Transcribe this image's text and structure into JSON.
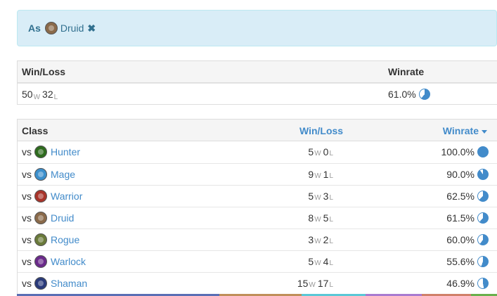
{
  "filter": {
    "prefix": "As",
    "class_name": "Druid",
    "class_icon": "druid-icon",
    "class_color": "#8a6a4a"
  },
  "summary": {
    "headers": {
      "winloss": "Win/Loss",
      "winrate": "Winrate"
    },
    "wins": "50",
    "wins_suffix": "W",
    "losses": "32",
    "losses_suffix": "L",
    "winrate": "61.0%",
    "winrate_value": 0.61
  },
  "classes": {
    "headers": {
      "class": "Class",
      "winloss": "Win/Loss",
      "winrate": "Winrate"
    },
    "vs_label": "vs",
    "rows": [
      {
        "name": "Hunter",
        "icon": "hunter-icon",
        "color": "#2e6b1e",
        "wins": "5",
        "losses": "0",
        "winrate": "100.0%",
        "value": 1.0
      },
      {
        "name": "Mage",
        "icon": "mage-icon",
        "color": "#3c8fcc",
        "wins": "9",
        "losses": "1",
        "winrate": "90.0%",
        "value": 0.9
      },
      {
        "name": "Warrior",
        "icon": "warrior-icon",
        "color": "#a8342a",
        "wins": "5",
        "losses": "3",
        "winrate": "62.5%",
        "value": 0.625
      },
      {
        "name": "Druid",
        "icon": "druid-icon",
        "color": "#8a6a4a",
        "wins": "8",
        "losses": "5",
        "winrate": "61.5%",
        "value": 0.615
      },
      {
        "name": "Rogue",
        "icon": "rogue-icon",
        "color": "#6a7a3a",
        "wins": "3",
        "losses": "2",
        "winrate": "60.0%",
        "value": 0.6
      },
      {
        "name": "Warlock",
        "icon": "warlock-icon",
        "color": "#6a2a8a",
        "wins": "5",
        "losses": "4",
        "winrate": "55.6%",
        "value": 0.556
      },
      {
        "name": "Shaman",
        "icon": "shaman-icon",
        "color": "#2a3a7a",
        "wins": "15",
        "losses": "17",
        "winrate": "46.9%",
        "value": 0.469
      }
    ],
    "suffix_w": "W",
    "suffix_l": "L"
  },
  "colors": {
    "accent": "#428bca",
    "strip": [
      "#5a6fb5",
      "#c08f5a",
      "#5bc8d6",
      "#a97bd0",
      "#d0806a",
      "#6ab04c"
    ]
  }
}
